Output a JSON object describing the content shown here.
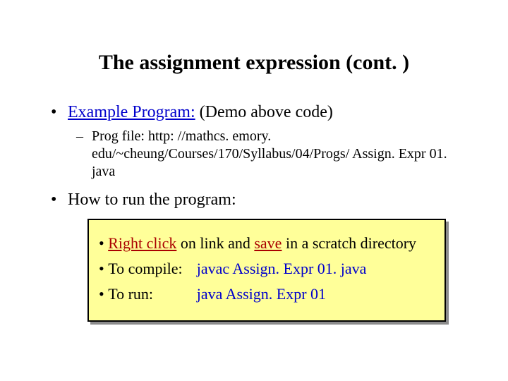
{
  "title": "The assignment expression (cont. )",
  "bullets": {
    "item1": {
      "prefix_underlined": "Example Program:",
      "rest": " (Demo above code)"
    },
    "item1_sub": {
      "label": "Prog file:",
      "url": "http: //mathcs. emory. edu/~cheung/Courses/170/Syllabus/04/Progs/ Assign. Expr 01. java"
    },
    "item2": "How to run the program:"
  },
  "box": {
    "row1": {
      "pre": "",
      "u1": "Right click",
      "mid": " on link and ",
      "u2": "save",
      "post": " in a scratch directory"
    },
    "row2": {
      "label": "To compile:",
      "cmd": "javac Assign. Expr 01. java"
    },
    "row3": {
      "label": "To run:",
      "cmd": "java  Assign. Expr 01"
    }
  }
}
